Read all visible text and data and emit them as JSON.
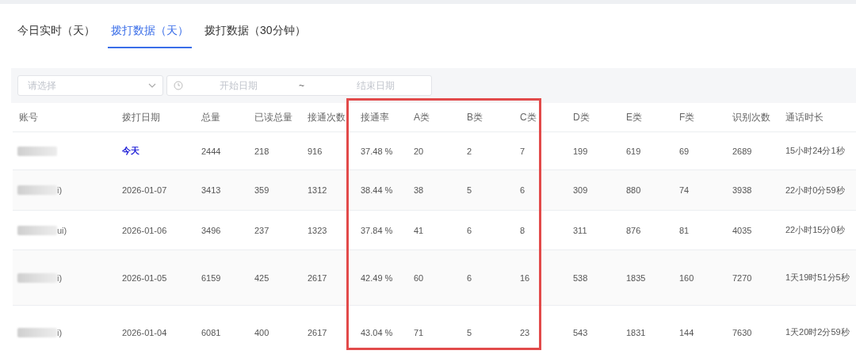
{
  "tabs": [
    {
      "label": "今日实时（天）",
      "selected": false
    },
    {
      "label": "拨打数据（天）",
      "selected": true
    },
    {
      "label": "拨打数据（30分钟）",
      "selected": false
    }
  ],
  "filters": {
    "select": {
      "placeholder": "请选择"
    },
    "date_range": {
      "start_placeholder": "开始日期",
      "separator": "~",
      "end_placeholder": "结束日期"
    }
  },
  "table": {
    "columns": [
      "账号",
      "拨打日期",
      "总量",
      "已读总量",
      "接通次数",
      "接通率",
      "A类",
      "B类",
      "C类",
      "D类",
      "E类",
      "F类",
      "识别次数",
      "通话时长"
    ],
    "rows": [
      {
        "date_is_link": true,
        "cells": [
          "",
          "今天",
          "2444",
          "218",
          "916",
          "37.48 %",
          "20",
          "2",
          "7",
          "199",
          "619",
          "69",
          "2689",
          "15小时24分1秒"
        ]
      },
      {
        "date_is_link": false,
        "cells": [
          "i)",
          "2026-01-07",
          "3413",
          "359",
          "1312",
          "38.44 %",
          "38",
          "5",
          "6",
          "309",
          "880",
          "74",
          "3938",
          "22小时0分59秒"
        ]
      },
      {
        "date_is_link": false,
        "cells": [
          "ui)",
          "2026-01-06",
          "3496",
          "237",
          "1323",
          "37.84 %",
          "41",
          "6",
          "8",
          "311",
          "876",
          "81",
          "4035",
          "22小时15分0秒"
        ]
      },
      {
        "date_is_link": false,
        "cells": [
          "i)",
          "2026-01-05",
          "6159",
          "425",
          "2617",
          "42.49 %",
          "60",
          "6",
          "16",
          "538",
          "1835",
          "160",
          "7270",
          "1天19时51分5秒"
        ]
      },
      {
        "date_is_link": false,
        "cells": [
          "i)",
          "2026-01-04",
          "6081",
          "400",
          "2617",
          "43.04 %",
          "71",
          "5",
          "23",
          "543",
          "1831",
          "144",
          "7630",
          "1天20时2分59秒"
        ]
      }
    ]
  }
}
